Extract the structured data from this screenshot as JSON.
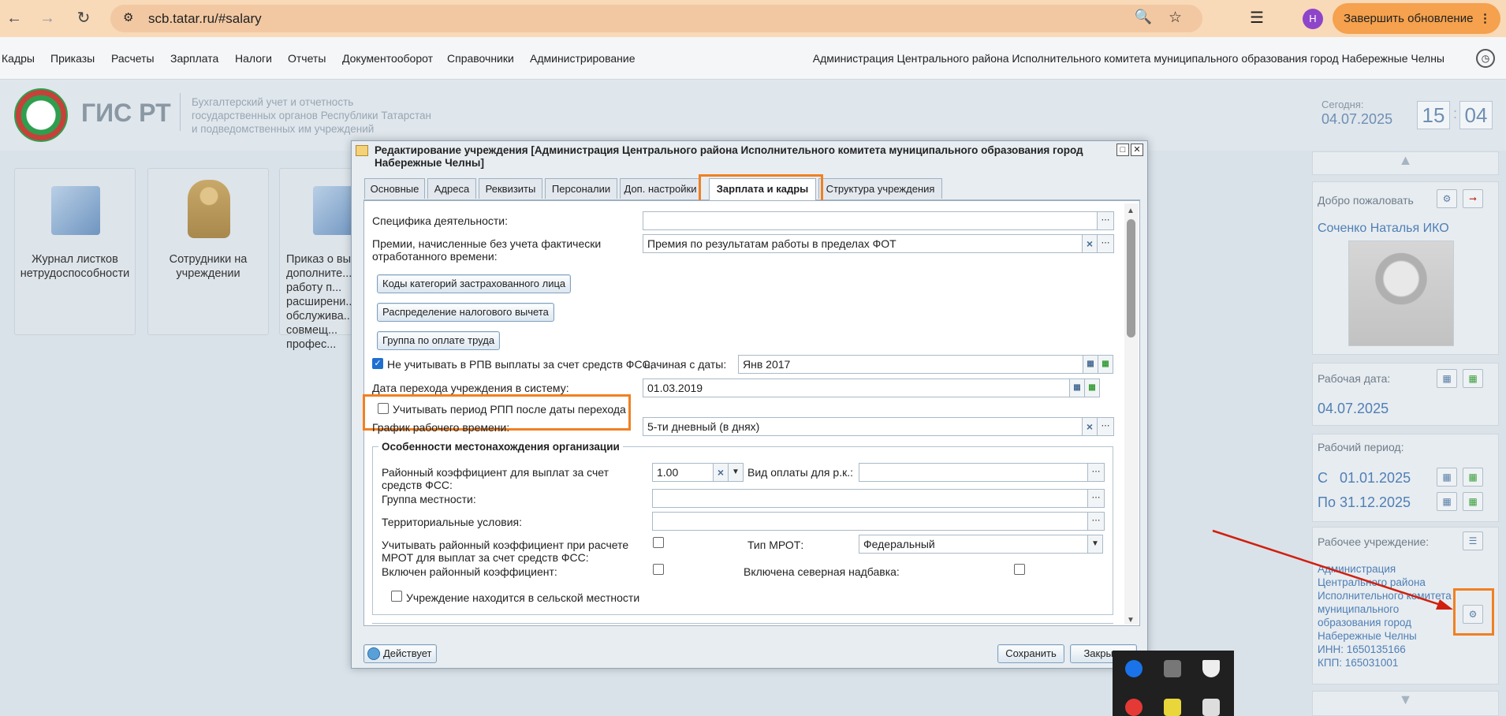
{
  "browser": {
    "url": "scb.tatar.ru/#salary",
    "profile_letter": "Н",
    "update_button": "Завершить обновление"
  },
  "menu": {
    "items": [
      "Кадры",
      "Приказы",
      "Расчеты",
      "Зарплата",
      "Налоги",
      "Отчеты",
      "Документооборот",
      "Справочники",
      "Администрирование"
    ],
    "organization": "Администрация Центрального района Исполнительного комитета муниципального образования город Набережные Челны"
  },
  "header": {
    "logo_text": "ГИС РТ",
    "description": [
      "Бухгалтерский учет и отчетность",
      "государственных органов Республики Татарстан",
      "и подведомственных им учреждений"
    ],
    "today_label": "Сегодня:",
    "today_date": "04.07.2025",
    "clock_hours": "15",
    "clock_minutes": "04"
  },
  "tiles": [
    {
      "label": "Журнал листков нетрудоспособности"
    },
    {
      "label": "Сотрудники на учреждении"
    },
    {
      "label": "Приказ о вы... дополните... работу п... расширени... обслужива... совмещ... профес..."
    }
  ],
  "right_panel": {
    "welcome_label": "Добро пожаловать",
    "user_name": "Соченко Наталья ИКО",
    "work_date_label": "Рабочая дата:",
    "work_date": "04.07.2025",
    "period_label": "Рабочий период:",
    "period_from": "С   01.01.2025",
    "period_to": "По 31.12.2025",
    "institution_label": "Рабочее учреждение:",
    "institution_lines": [
      "Администрация",
      "Центрального района",
      "Исполнительного комитета",
      "муниципального",
      "образования город",
      "Набережные Челны",
      "ИНН: 1650135166",
      "КПП: 165031001"
    ]
  },
  "dialog": {
    "title": "Редактирование учреждения [Администрация Центрального района Исполнительного комитета муниципального образования город Набережные Челны]",
    "tabs": [
      "Основные",
      "Адреса",
      "Реквизиты",
      "Персоналии",
      "Доп. настройки",
      "Зарплата и кадры",
      "Структура учреждения"
    ],
    "active_tab": "Зарплата и кадры",
    "fields": {
      "specifics_label": "Специфика деятельности:",
      "specifics_value": "",
      "bonus_label": "Премии, начисленные без учета фактически отработанного времени:",
      "bonus_value": "Премия по результатам работы в пределах ФОТ",
      "btn_codes": "Коды категорий застрахованного лица",
      "btn_tax": "Распределение налогового вычета",
      "btn_group": "Группа по оплате труда",
      "fss_label": "Не учитывать в РПВ выплаты за счет средств ФСС,",
      "fss_date_label": "начиная с даты:",
      "fss_date_value": "Янв 2017",
      "transition_label": "Дата перехода учреждения в систему:",
      "transition_value": "01.03.2019",
      "rpp_label": "Учитывать период РПП после даты перехода",
      "schedule_label": "График рабочего времени:",
      "schedule_value": "5-ти дневный (в днях)"
    },
    "location": {
      "legend": "Особенности местонахождения организации",
      "coef_label": "Районный коэффициент для выплат за счет средств ФСС:",
      "coef_value": "1.00",
      "pay_type_label": "Вид оплаты для р.к.:",
      "group_label": "Группа местности:",
      "territory_label": "Территориальные условия:",
      "mrot_coef_label": "Учитывать районный коэффициент при расчете МРОТ для выплат за счет средств ФСС:",
      "mrot_type_label": "Тип МРОТ:",
      "mrot_type_value": "Федеральный",
      "regional_label": "Включен районный коэффициент:",
      "north_label": "Включена северная надбавка:",
      "rural_label": "Учреждение находится в сельской местности"
    },
    "status": "Действует",
    "save": "Сохранить",
    "close": "Закрыть"
  }
}
